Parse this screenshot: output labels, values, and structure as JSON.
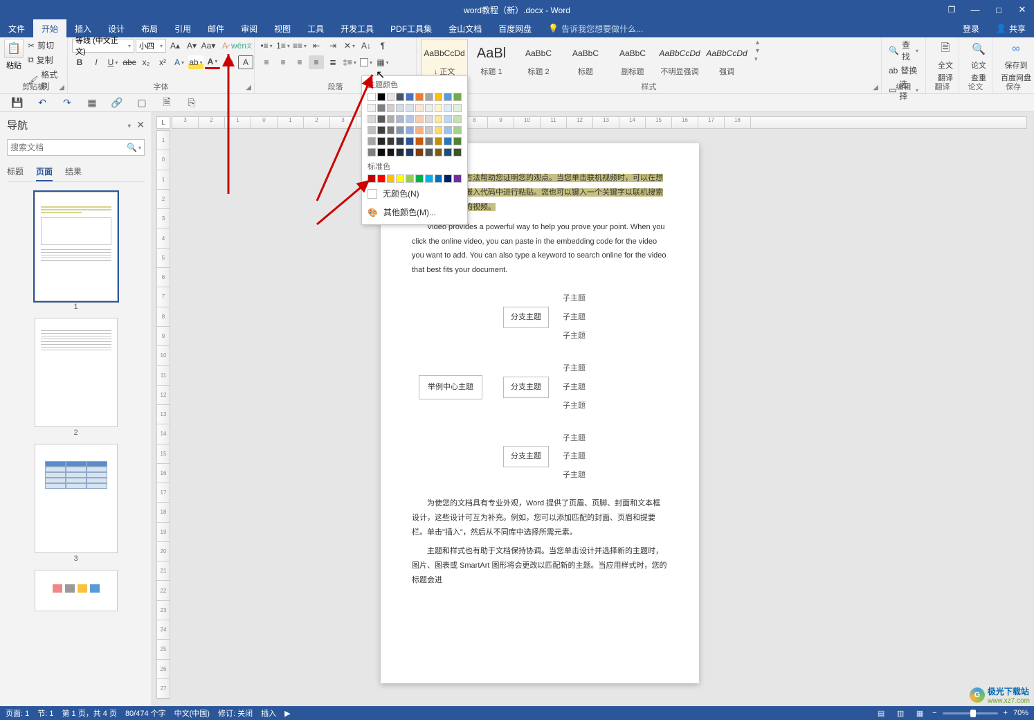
{
  "title": "word教程（新）.docx - Word",
  "window_controls": {
    "restore": "❐",
    "min": "—",
    "max": "□",
    "close": "✕"
  },
  "tabs_right": {
    "login": "登录",
    "share": "共享"
  },
  "tabs": [
    "文件",
    "开始",
    "插入",
    "设计",
    "布局",
    "引用",
    "邮件",
    "审阅",
    "视图",
    "工具",
    "开发工具",
    "PDF工具集",
    "金山文档",
    "百度网盘"
  ],
  "tabs_active_index": 1,
  "tellme": {
    "icon": "💡",
    "placeholder": "告诉我您想要做什么..."
  },
  "ribbon": {
    "clipboard": {
      "label": "剪贴板",
      "paste": "粘贴",
      "cut": "剪切",
      "copy": "复制",
      "fmt": "格式刷"
    },
    "font": {
      "label": "字体",
      "name": "等线 (中文正文)",
      "size": "小四"
    },
    "paragraph": {
      "label": "段落"
    },
    "styles": {
      "label": "样式",
      "items": [
        {
          "preview": "AaBbCcDd",
          "label": "↓ 正文",
          "sel": true
        },
        {
          "preview": "AaBl",
          "label": "标题 1",
          "big": true
        },
        {
          "preview": "AaBbC",
          "label": "标题 2"
        },
        {
          "preview": "AaBbC",
          "label": "标题"
        },
        {
          "preview": "AaBbC",
          "label": "副标题"
        },
        {
          "preview": "AaBbCcDd",
          "label": "不明显强调",
          "it": true
        },
        {
          "preview": "AaBbCcDd",
          "label": "强调",
          "it": true
        }
      ]
    },
    "editing": {
      "label": "编辑",
      "find": "查找",
      "replace": "替换",
      "select": "选择"
    },
    "fulltrans": {
      "label": "翻译",
      "line1": "全文",
      "line2": "翻译"
    },
    "thesis": {
      "label": "论文",
      "line1": "论文",
      "line2": "查重"
    },
    "baidu": {
      "label": "保存",
      "line1": "保存到",
      "line2": "百度网盘"
    }
  },
  "nav": {
    "title": "导航",
    "search_placeholder": "搜索文档",
    "tabs": [
      "标题",
      "页面",
      "结果"
    ],
    "active": 1,
    "pages": [
      "1",
      "2",
      "3"
    ]
  },
  "ruler_corner": "L",
  "picker": {
    "theme_title": "主题颜色",
    "theme_row": [
      "#ffffff",
      "#000000",
      "#e7e6e6",
      "#44546a",
      "#4472c4",
      "#ed7d31",
      "#a5a5a5",
      "#ffc000",
      "#5b9bd5",
      "#70ad47"
    ],
    "theme_shades": [
      [
        "#f2f2f2",
        "#7f7f7f",
        "#d0cece",
        "#d6dce4",
        "#d9e2f3",
        "#fbe5d5",
        "#ededed",
        "#fff2cc",
        "#deebf6",
        "#e2efd9"
      ],
      [
        "#d8d8d8",
        "#595959",
        "#aeabab",
        "#adb9ca",
        "#b4c6e7",
        "#f7cbac",
        "#dbdbdb",
        "#fee599",
        "#bdd7ee",
        "#c5e0b3"
      ],
      [
        "#bfbfbf",
        "#3f3f3f",
        "#757070",
        "#8496b0",
        "#8eaadb",
        "#f4b183",
        "#c9c9c9",
        "#ffd965",
        "#9cc3e5",
        "#a8d08d"
      ],
      [
        "#a5a5a5",
        "#262626",
        "#3a3838",
        "#323f4f",
        "#2f5496",
        "#c55a11",
        "#7b7b7b",
        "#bf9000",
        "#2e75b5",
        "#538135"
      ],
      [
        "#7f7f7f",
        "#0c0c0c",
        "#171616",
        "#222a35",
        "#1f3864",
        "#833c0b",
        "#525252",
        "#7f6000",
        "#1e4e79",
        "#375623"
      ]
    ],
    "std_title": "标准色",
    "std": [
      "#c00000",
      "#ff0000",
      "#ffc000",
      "#ffff00",
      "#92d050",
      "#00b050",
      "#00b0f0",
      "#0070c0",
      "#002060",
      "#7030a0"
    ],
    "none": "无颜色(N)",
    "more": "其他颜色(M)..."
  },
  "doc": {
    "hl": "功能强大的方法帮助您证明您的观点。当您单击联机视频时，可以在想要添加的视频的嵌入代码中进行粘贴。您也可以键入一个关键字以联机搜索最适合您的文档的视频。",
    "p2": "Video provides a powerful way to help you prove your point. When you click the online video, you can paste in the embedding code for the video you want to add. You can also type a keyword to search online for the video that best fits your document.",
    "p3": "为使您的文档具有专业外观，Word 提供了页眉、页脚、封面和文本框设计，这些设计可互为补充。例如，您可以添加匹配的封面、页眉和提要栏。单击\"插入\"，然后从不同库中选择所需元素。",
    "p4": "主题和样式也有助于文档保持协调。当您单击设计并选择新的主题时，图片、图表或 SmartArt 图形将会更改以匹配新的主题。当应用样式时，您的标题会进",
    "mm_center": "举例中心主题",
    "mm_branch": "分支主题",
    "mm_leaf": "子主题"
  },
  "status": {
    "page": "页面: 1",
    "section": "节: 1",
    "pageof": "第 1 页，共 4 页",
    "words": "80/474 个字",
    "lang": "中文(中国)",
    "track": "修订: 关闭",
    "mode": "插入",
    "zoom": "70%"
  },
  "watermark": {
    "text1": "极光下载站",
    "text2": "www.xz7.com"
  }
}
